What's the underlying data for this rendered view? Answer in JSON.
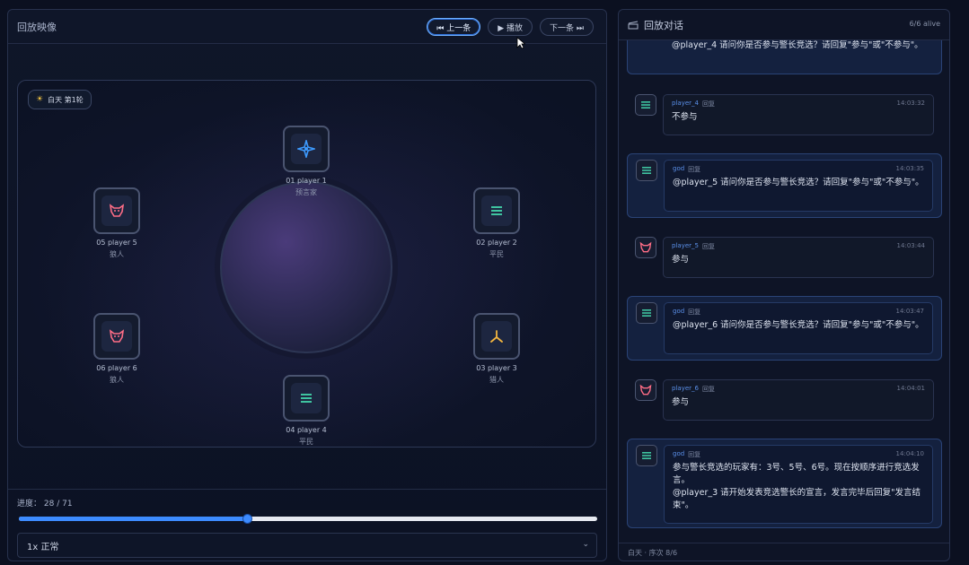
{
  "replay": {
    "title": "回放映像",
    "prev_label": "⏮ 上一条",
    "play_label": "▶ 播放",
    "next_label": "下一条 ⏭",
    "phase_label": "白天 第1轮",
    "progress_label": "进度：",
    "progress_text": "28 / 71",
    "progress_value": 28,
    "progress_total": 71,
    "speed_selected": "1x 正常"
  },
  "seats": [
    {
      "name": "01 player 1",
      "role": "预言家",
      "icon": "compass-star-icon",
      "color": "#3d9bff"
    },
    {
      "name": "02 player 2",
      "role": "平民",
      "icon": "villager-lines-icon",
      "color": "#3fc4a0"
    },
    {
      "name": "03 player 3",
      "role": "猎人",
      "icon": "hunter-bow-icon",
      "color": "#f4b63f"
    },
    {
      "name": "04 player 4",
      "role": "平民",
      "icon": "villager-lines-icon",
      "color": "#3fc4a0"
    },
    {
      "name": "05 player 5",
      "role": "狼人",
      "icon": "wolf-mask-icon",
      "color": "#ff6d86"
    },
    {
      "name": "06 player 6",
      "role": "狼人",
      "icon": "wolf-mask-icon",
      "color": "#ff6d86"
    }
  ],
  "chat": {
    "title": "回放对话",
    "alive": "6/6 alive",
    "footer": "白天 · 序次 8/6",
    "messages": [
      {
        "type": "god",
        "sender": "",
        "tag": "",
        "time": "",
        "text": "@player_4 请问你是否参与警长竞选？请回复\"参与\"或\"不参与\"。"
      },
      {
        "type": "player",
        "sender": "player_4",
        "tag": "回复",
        "time": "14:03:32",
        "text": "不参与",
        "icon": "villager-lines-icon"
      },
      {
        "type": "god",
        "sender": "god",
        "tag": "回复",
        "time": "14:03:35",
        "text": "@player_5 请问你是否参与警长竞选？请回复\"参与\"或\"不参与\"。"
      },
      {
        "type": "player",
        "sender": "player_5",
        "tag": "回复",
        "time": "14:03:44",
        "text": "参与",
        "icon": "wolf-mask-icon"
      },
      {
        "type": "god",
        "sender": "god",
        "tag": "回复",
        "time": "14:03:47",
        "text": "@player_6 请问你是否参与警长竞选？请回复\"参与\"或\"不参与\"。"
      },
      {
        "type": "player",
        "sender": "player_6",
        "tag": "回复",
        "time": "14:04:01",
        "text": "参与",
        "icon": "wolf-mask-icon"
      },
      {
        "type": "god",
        "sender": "god",
        "tag": "回复",
        "time": "14:04:10",
        "text": "参与警长竞选的玩家有：3号、5号、6号。现在按顺序进行竞选发言。\n@player_3 请开始发表竞选警长的宣言，发言完毕后回复\"发言结束\"。"
      }
    ]
  },
  "colors": {
    "accent": "#3d8bff",
    "god_bubble": "#14213f",
    "wolf": "#ff6d86",
    "villager": "#3fc4a0",
    "seer": "#3d9bff",
    "hunter": "#f4b63f"
  }
}
